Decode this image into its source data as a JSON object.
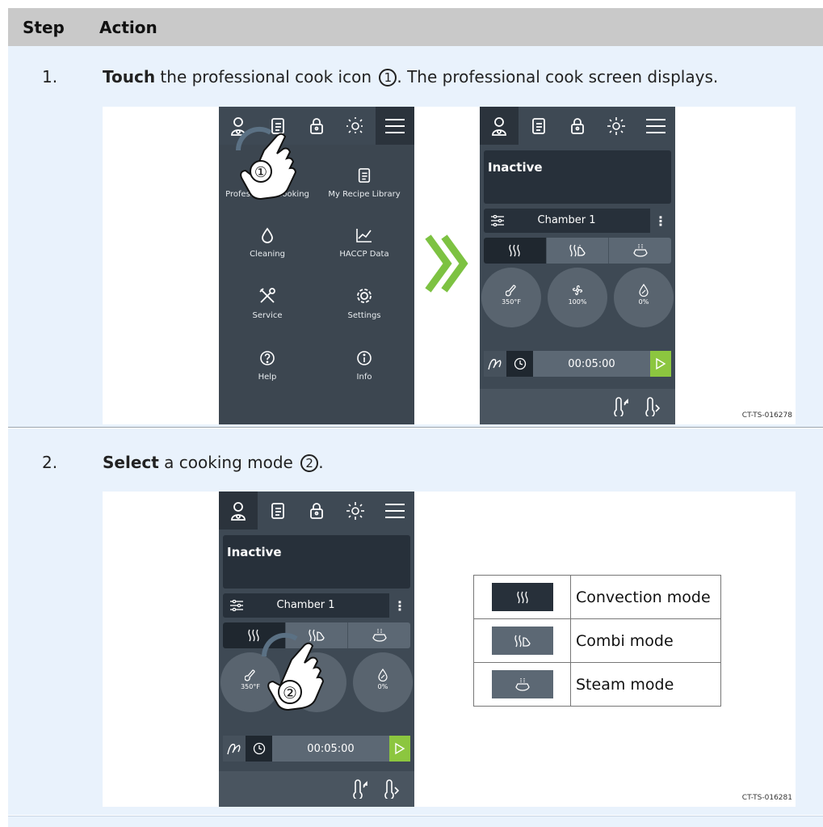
{
  "table": {
    "header_step": "Step",
    "header_action": "Action"
  },
  "steps": [
    {
      "number": "1.",
      "verb": "Touch",
      "text_before": " the professional cook icon ",
      "marker": "1",
      "text_after": ". The professional cook screen displays.",
      "figure_id": "CT-TS-016278"
    },
    {
      "number": "2.",
      "verb": "Select",
      "text_before": " a cooking mode ",
      "marker": "2",
      "text_after": ".",
      "figure_id": "CT-TS-016281"
    }
  ],
  "menu_screen": {
    "items": [
      {
        "label": "Professional Cooking",
        "icon": "person-chef-icon"
      },
      {
        "label": "My Recipe Library",
        "icon": "recipe-book-icon"
      },
      {
        "label": "Cleaning",
        "icon": "drop-icon"
      },
      {
        "label": "HACCP Data",
        "icon": "chart-icon"
      },
      {
        "label": "Service",
        "icon": "tools-icon"
      },
      {
        "label": "Settings",
        "icon": "gear-icon"
      },
      {
        "label": "Help",
        "icon": "question-icon"
      },
      {
        "label": "Info",
        "icon": "info-icon"
      }
    ],
    "callout": "①"
  },
  "cook_screen": {
    "status": "Inactive",
    "chamber": "Chamber 1",
    "kebab": "⋮",
    "dial_temp": "350°F",
    "dial_fan": "100%",
    "dial_humidity": "0%",
    "timer": "00:05:00"
  },
  "cook_screen_2": {
    "status": "Inactive",
    "chamber": "Chamber 1",
    "kebab": "⋮",
    "dial_temp": "350°F",
    "dial_humidity": "0%",
    "timer": "00:05:00",
    "callout": "②"
  },
  "legend": [
    {
      "label": "Convection mode",
      "icon": "convection-icon"
    },
    {
      "label": "Combi mode",
      "icon": "combi-icon"
    },
    {
      "label": "Steam mode",
      "icon": "steam-icon"
    }
  ],
  "colors": {
    "screen_bg": "#3e4954",
    "accent_green": "#8cc63f",
    "row_bg": "#e9f2fc",
    "header_bg": "#c9c9c9"
  }
}
